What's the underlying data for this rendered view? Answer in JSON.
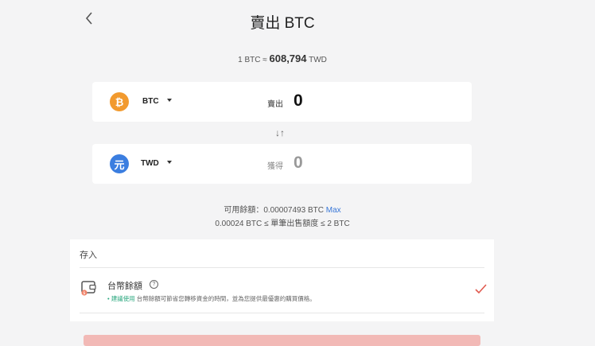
{
  "header": {
    "title": "賣出 BTC"
  },
  "rate": {
    "prefix": "1 BTC ≈ ",
    "value": "608,794",
    "unit": "TWD"
  },
  "sell": {
    "coin_glyph": "₿",
    "currency": "BTC",
    "action": "賣出",
    "amount": "0"
  },
  "receive": {
    "coin_glyph": "元",
    "currency": "TWD",
    "action": "獲得",
    "amount": "0"
  },
  "swap_icon": "↓↑",
  "balance": {
    "text": "可用餘額：0.00007493 BTC",
    "max_label": "Max"
  },
  "limit": {
    "text": "0.00024 BTC ≤ 單筆出售額度 ≤ 2 BTC"
  },
  "deposit": {
    "heading": "存入",
    "method_name": "台幣餘額",
    "help_glyph": "?",
    "desc_recommend": "建議使用",
    "desc_text": " 台幣餘額可節省您轉移資金的時間，並為您提供最優惠的購買價格。"
  },
  "colors": {
    "btc": "#f29a2e",
    "twd": "#3b7ee0",
    "accent": "#3a78d8",
    "check": "#e05a4f",
    "submit": "#f2b9b6"
  },
  "icons": {
    "back": "chevron-left-icon",
    "wallet": "wallet-icon",
    "check": "check-icon"
  }
}
